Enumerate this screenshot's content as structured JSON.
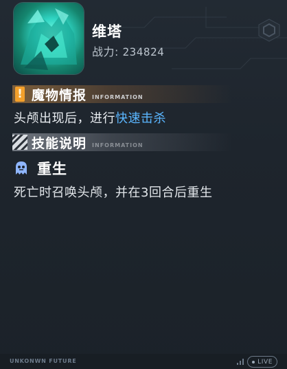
{
  "monster": {
    "name": "维塔",
    "power_label": "战力:",
    "power_value": "234824",
    "portrait_icon": "teal-crystal-beast-portrait"
  },
  "intel_section": {
    "title": "魔物情报",
    "subtitle": "INFORMATION",
    "icon": "exclamation-icon",
    "text_before": "头颅出现后，进行",
    "text_highlight": "快速击杀",
    "highlight_color": "#5ab6ff",
    "accent_color": "#f4a02b"
  },
  "skill_section": {
    "title": "技能说明",
    "subtitle": "INFORMATION",
    "icon": "hatched-stripes-icon",
    "skill_icon": "ghost-skull-icon",
    "skill_name": "重生",
    "skill_desc": "死亡时召唤头颅，并在3回合后重生"
  },
  "footer": {
    "left_text": "UNKONWN FUTURE",
    "signal_icon": "signal-bars-icon",
    "live_label": "LIVE"
  }
}
